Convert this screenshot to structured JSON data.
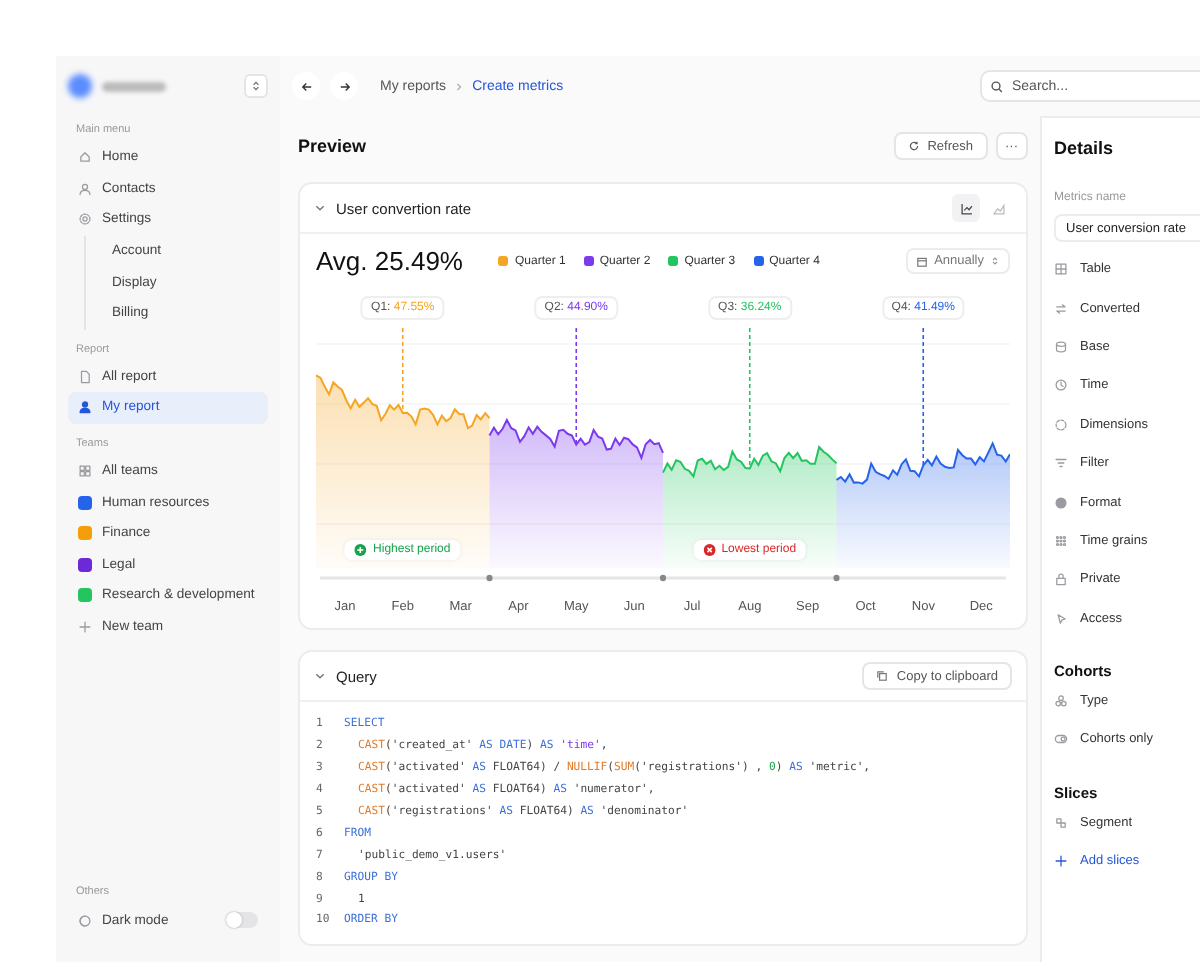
{
  "sidebar": {
    "sections": [
      {
        "title": "Main menu",
        "items": [
          {
            "label": "Home",
            "selected": false
          },
          {
            "label": "Contacts",
            "selected": false
          },
          {
            "label": "Settings",
            "selected": false,
            "children": [
              {
                "label": "Account",
                "selected": false
              },
              {
                "label": "Display",
                "selected": false
              },
              {
                "label": "Billing",
                "selected": false
              }
            ]
          }
        ]
      },
      {
        "title": "Report",
        "items": [
          {
            "label": "All report",
            "selected": false
          },
          {
            "label": "My report",
            "selected": true
          }
        ]
      },
      {
        "title": "Teams",
        "items": [
          {
            "label": "All teams",
            "kind": "link",
            "selected": false
          },
          {
            "label": "Human resources",
            "kind": "team",
            "color": "#2563eb",
            "selected": false
          },
          {
            "label": "Finance",
            "kind": "team",
            "color": "#f59e0b",
            "selected": false
          },
          {
            "label": "Legal",
            "kind": "team",
            "color": "#6d28d9",
            "selected": false
          },
          {
            "label": "Research & development",
            "kind": "team",
            "color": "#22c55e",
            "selected": false
          },
          {
            "label": "New team",
            "kind": "add",
            "selected": false
          }
        ]
      }
    ],
    "others": {
      "title": "Others",
      "dark_mode": {
        "label": "Dark mode",
        "on": false
      }
    }
  },
  "breadcrumb": [
    {
      "label": "My reports",
      "selected": false
    },
    {
      "label": "Create metrics",
      "selected": true
    }
  ],
  "search": {
    "placeholder": "Search..."
  },
  "preview": {
    "title": "Preview",
    "refresh": "Refresh",
    "more": "···",
    "chart_card": {
      "title": "User convertion rate",
      "views": [
        {
          "selected": true
        },
        {
          "selected": false
        }
      ],
      "average": "Avg. 25.49%",
      "period": "Annually",
      "quarters": [
        {
          "legend": "Quarter 1",
          "color": "#f5a524",
          "callout_label": "Q1:",
          "callout_value": "47.55%",
          "badge": {
            "kind": "highest",
            "label": "Highest period"
          }
        },
        {
          "legend": "Quarter 2",
          "color": "#7c3aed",
          "callout_label": "Q2:",
          "callout_value": "44.90%"
        },
        {
          "legend": "Quarter 3",
          "color": "#22c55e",
          "callout_label": "Q3:",
          "callout_value": "36.24%",
          "badge": {
            "kind": "lowest",
            "label": "Lowest period"
          }
        },
        {
          "legend": "Quarter 4",
          "color": "#2563eb",
          "callout_label": "Q4:",
          "callout_value": "41.49%"
        }
      ],
      "months": [
        "Jan",
        "Feb",
        "Mar",
        "Apr",
        "May",
        "Jun",
        "Jul",
        "Aug",
        "Sep",
        "Oct",
        "Nov",
        "Dec"
      ]
    },
    "query": {
      "title": "Query",
      "copy": "Copy to clipboard",
      "lines": [
        {
          "number": "1",
          "indent": false,
          "tokens": [
            {
              "text": "SELECT",
              "kind": "keyword"
            }
          ]
        },
        {
          "number": "2",
          "indent": true,
          "tokens": [
            {
              "text": "CAST",
              "kind": "function"
            },
            {
              "text": "('created_at' "
            },
            {
              "text": "AS",
              "kind": "keyword"
            },
            {
              "text": " DATE",
              "kind": "type"
            },
            {
              "text": ") "
            },
            {
              "text": "AS",
              "kind": "keyword"
            },
            {
              "text": " 'time'",
              "kind": "alias"
            },
            {
              "text": ","
            }
          ]
        },
        {
          "number": "3",
          "indent": true,
          "tokens": [
            {
              "text": "CAST",
              "kind": "function"
            },
            {
              "text": "('activated' "
            },
            {
              "text": "AS",
              "kind": "keyword"
            },
            {
              "text": " FLOAT64) / "
            },
            {
              "text": "NULLIF",
              "kind": "function"
            },
            {
              "text": "("
            },
            {
              "text": "SUM",
              "kind": "function"
            },
            {
              "text": "('registrations') , "
            },
            {
              "text": "0",
              "kind": "number"
            },
            {
              "text": ") "
            },
            {
              "text": "AS",
              "kind": "keyword"
            },
            {
              "text": " 'metric',"
            }
          ]
        },
        {
          "number": "4",
          "indent": true,
          "tokens": [
            {
              "text": "CAST",
              "kind": "function"
            },
            {
              "text": "('activated' "
            },
            {
              "text": "AS",
              "kind": "keyword"
            },
            {
              "text": " FLOAT64) "
            },
            {
              "text": "AS",
              "kind": "keyword"
            },
            {
              "text": " 'numerator',"
            }
          ]
        },
        {
          "number": "5",
          "indent": true,
          "tokens": [
            {
              "text": "CAST",
              "kind": "function"
            },
            {
              "text": "('registrations' "
            },
            {
              "text": "AS",
              "kind": "keyword"
            },
            {
              "text": " FLOAT64) "
            },
            {
              "text": "AS",
              "kind": "keyword"
            },
            {
              "text": " 'denominator'"
            }
          ]
        },
        {
          "number": "6",
          "indent": false,
          "tokens": [
            {
              "text": "FROM",
              "kind": "keyword"
            }
          ]
        },
        {
          "number": "7",
          "indent": true,
          "tokens": [
            {
              "text": "'public_demo_v1.users'"
            }
          ]
        },
        {
          "number": "8",
          "indent": false,
          "tokens": [
            {
              "text": "GROUP BY",
              "kind": "keyword"
            }
          ]
        },
        {
          "number": "9",
          "indent": true,
          "tokens": [
            {
              "text": "1"
            }
          ]
        },
        {
          "number": "10",
          "indent": false,
          "tokens": [
            {
              "text": "ORDER BY",
              "kind": "keyword"
            }
          ]
        }
      ]
    }
  },
  "details": {
    "title": "Details",
    "metrics_name_label": "Metrics name",
    "metrics_name": "User conversion rate",
    "properties": [
      "Table",
      "Converted",
      "Base",
      "Time",
      "Dimensions",
      "Filter",
      "Format",
      "Time grains",
      "Private",
      "Access"
    ],
    "cohorts": {
      "title": "Cohorts",
      "items": [
        "Type",
        "Cohorts only"
      ]
    },
    "slices": {
      "title": "Slices",
      "items": [
        "Segment"
      ],
      "add": "Add slices"
    }
  }
}
